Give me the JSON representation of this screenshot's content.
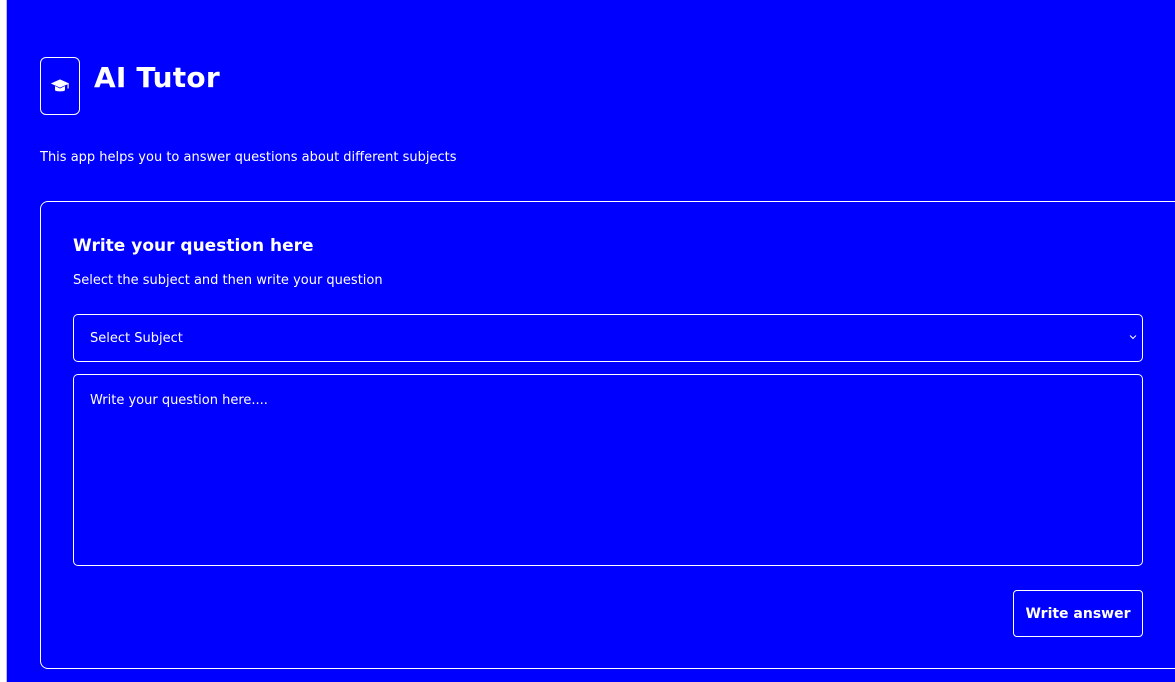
{
  "app": {
    "title": "AI Tutor",
    "subtitle": "This app helps you to answer questions about different subjects",
    "logo_icon": "graduation-cap-icon"
  },
  "form": {
    "title": "Write your question here",
    "subtitle": "Select the subject and then write your question",
    "subject_select": {
      "selected": "Select Subject",
      "icon": "chevron-down-icon"
    },
    "question_input": {
      "placeholder": "Write your question here...."
    },
    "submit_label": "Write answer"
  },
  "colors": {
    "background": "#0000ff",
    "foreground": "#ffffff"
  }
}
